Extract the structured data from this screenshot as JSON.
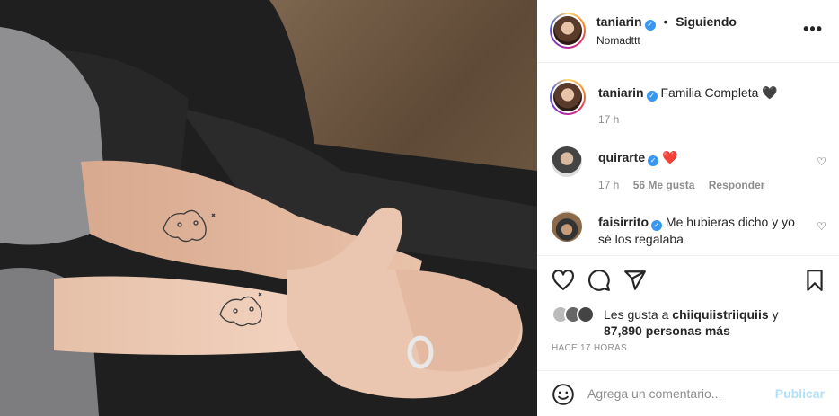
{
  "post": {
    "author": "taniarin",
    "follow_state": "Siguiendo",
    "separator": "•",
    "location": "Nomadttt",
    "verified_glyph": "✓",
    "more_icon": "more-options-icon",
    "image_description_icon": "photo"
  },
  "caption": {
    "username": "taniarin",
    "text": "Familia Completa",
    "emoji": "🖤",
    "time": "17 h"
  },
  "comments": [
    {
      "username": "quirarte",
      "text": "",
      "emoji": "❤️",
      "time": "17 h",
      "likes": "56 Me gusta",
      "reply": "Responder"
    },
    {
      "username": "faisirrito",
      "text": "Me hubieras dicho y yo sé los regalaba",
      "emoji": ""
    }
  ],
  "likes": {
    "prefix": "Les gusta a",
    "user": "chiiquiistriiquiis",
    "connector": "y",
    "count": "87,890 personas más"
  },
  "posted_ago": "HACE 17 HORAS",
  "add_comment": {
    "placeholder": "Agrega un comentario...",
    "publish": "Publicar"
  },
  "colors": {
    "verified": "#3897f0",
    "publish_disabled": "#b2dffc",
    "meta_gray": "#8e8e8e",
    "heart_red": "#ed4956"
  }
}
